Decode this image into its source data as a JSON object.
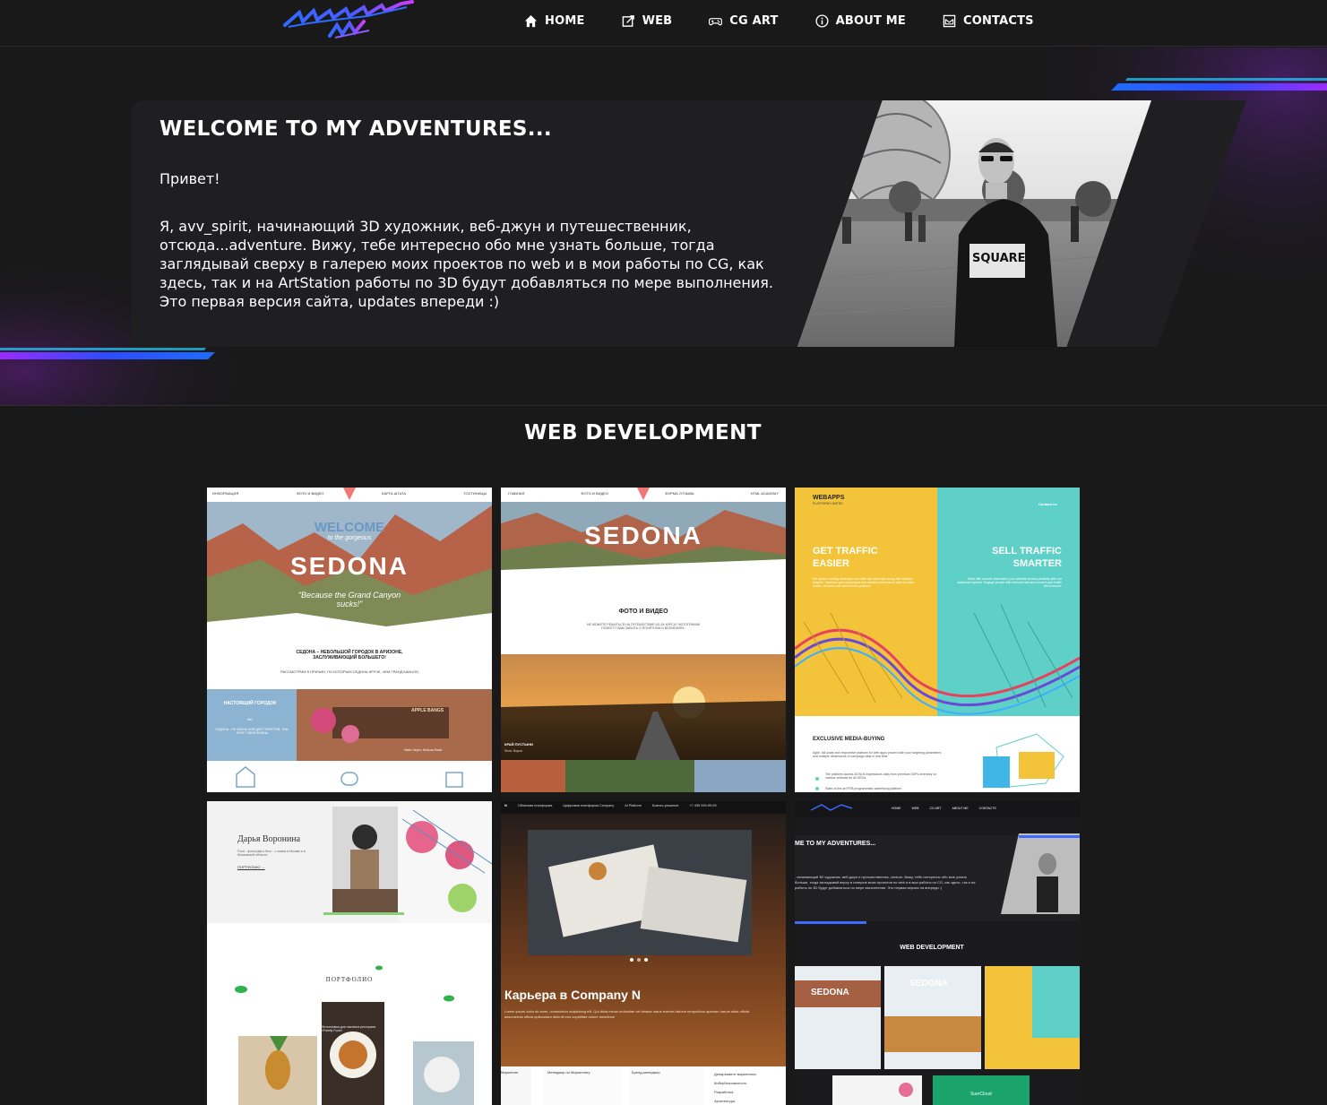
{
  "nav": {
    "logo_text": "ADVENTURE AVV",
    "items": [
      {
        "label": "HOME",
        "icon": "home-icon"
      },
      {
        "label": "WEB",
        "icon": "web-icon"
      },
      {
        "label": "CG ART",
        "icon": "gamepad-icon"
      },
      {
        "label": "ABOUT ME",
        "icon": "info-icon"
      },
      {
        "label": "CONTACTS",
        "icon": "mail-icon"
      }
    ]
  },
  "hero": {
    "title": "WELCOME TO MY ADVENTURES...",
    "greeting": "Привет!",
    "text": "Я, avv_spirit, начинающий 3D художник, веб-джун и путешественник, отсюда...adventure. Вижу, тебе интересно обо мне узнать больше, тогда заглядывай сверху в галерею моих проектов по web и в мои работы по CG, как здесь, так и на ArtStation работы по 3D будут добавляться по мере выполнения. Это первая версия сайта, updates впереди :)",
    "photo_shirt_text": "SQUARE"
  },
  "web_section": {
    "title": "WEB DEVELOPMENT",
    "projects": [
      {
        "nav": [
          "ИНФОРМАЦИЯ",
          "ФОТО И ВИДЕО",
          "КАРТА ШТАТА",
          "ГОСТИНИЦЫ"
        ],
        "welcome": "WELCOME",
        "sub": "to the gorgeous",
        "title": "SEDONA",
        "quote": "\"Because the Grand Canyon sucks!\"",
        "heading": "СЕДОНА – НЕБОЛЬШОЙ ГОРОДОК В АРИЗОНЕ, ЗАСЛУЖИВАЮЩИЙ БОЛЬШЕГО!",
        "subheading": "РАССМОТРИМ 5 ПРИЧИН, ПО КОТОРЫМ СЕДОНА КРУЧЕ, ЧЕМ ГРАНД КАНЬОН",
        "card": "НАСТОЯЩИЙ ГОРОДОК",
        "card_num": "№1",
        "card_text": "СЕДОНА - НЕ ОЧЕНЬ КОЙ ДЛЯ ТУРИСТОВ, ТАМ ТЕЧЕТ СВОЯ ЖИЗНЬ",
        "sign": "APPLE BANGS",
        "caption": "Нейл Херст, Sedona Road"
      },
      {
        "nav": [
          "ГЛАВНАЯ",
          "ФОТО И ВИДЕО",
          "ФОРМА ОТЗЫВА",
          "HTML ACADEMY"
        ],
        "title": "SEDONA",
        "heading": "ФОТО И ВИДЕО",
        "text": "НЕ МОЖЕТЕ РЕШИТЬСЯ НА ПУТЕШЕСТВИЕ ИЗ-ЗА КУРСА? ФОТОГРАФИИ ПОМОГУТ ВАМ ЗАБЫТЬ О ПОНЯТНОМ И ВОЛНЕНИЯХ.",
        "caption": "КРАЙ ПУСТЫНИ",
        "caption2": "Фото: Ворон"
      },
      {
        "brand": "WEBAPPS",
        "brand_sub": "PLATFORM LIMITED",
        "contact": "Contact us",
        "left_title": "GET TRAFFIC EASIER",
        "left_text": "We deliver winning strategies and offer top sales tips along with industry insights. Optimize your campaigns and mobile performance with our data-driven, demand-side self-service platform!",
        "right_title": "SELL TRAFFIC SMARTER",
        "right_text": "Work with adverts that match your website visitors perfectly with our advanced system. Engage people with relevant ads and convert your traffic into revenue.",
        "bottom_title": "EXCLUSIVE MEDIA-BUYING",
        "bottom_text": "Agile, full-scale and responsive platform for web apps proven both your targeting parameters and multiple dimensions of campaign data in real time.",
        "bullet1": "The platform access 30 BLN impressions daily from premium SSPs inventory on various verticals for all GEOs.",
        "bullet2": "State-of-the-art RTB programmatic advertising platform"
      },
      {
        "name": "Дарья Воронина",
        "small": "Food - фотограф и блог - о жизни в Москве и в Московской области",
        "link": "ПОРТФОЛИО →",
        "section": "ПОРТФОЛИО",
        "caption": "Фотосъемка для листинга ресторана «Family Food»"
      },
      {
        "nav": [
          "Облачная платформа",
          "Цифровая платформа Company",
          "AI Platform",
          "Бизнес-решение",
          "+7 495 999-99-99"
        ],
        "title": "Карьера в Company N",
        "text": "Lorem ipsum dolor sit amet, consectetur adipisicing elit. Qui dicta minus molestiae vel beatae natus eveniet ratione temporibus aperiam harum alias officiis assumenda officia quibusdam deleniti eos cupiditate dolore doloribus!",
        "tabs": [
          "Маркетинг",
          "Менеджер по Маркетингу",
          "Бренд-менеджер"
        ],
        "list": [
          "Департамент маркетинга",
          "Кибербезопасность",
          "Разработка",
          "Архитектура"
        ]
      },
      {
        "nav": [
          "HOME",
          "WEB",
          "CG ART",
          "ABOUT ME",
          "CONTACTS"
        ],
        "title": "ME TO MY ADVENTURES...",
        "text": ", начинающий 3D художник, веб-джун и путешественник, venture. Вижу, тебе интересно обо мне узнать больше, тогда заглядывай верху в галерею моих проектов по web и в мои работы по CG, как здесь, так и на работы по 3D будут добавляться по мере выполнения. Это первая версия на впереди :)",
        "section": "WEB DEVELOPMENT",
        "mini_title": "SEDONA",
        "mini_card": "SuerCloud"
      }
    ]
  },
  "colors": {
    "background": "#19191a",
    "card": "#1f1f21",
    "accent_blue": "#1e6bff",
    "accent_purple": "#8a2be2",
    "accent_cyan": "#1fd3ff",
    "yellow": "#f3c43a",
    "teal": "#5fd0c8"
  }
}
